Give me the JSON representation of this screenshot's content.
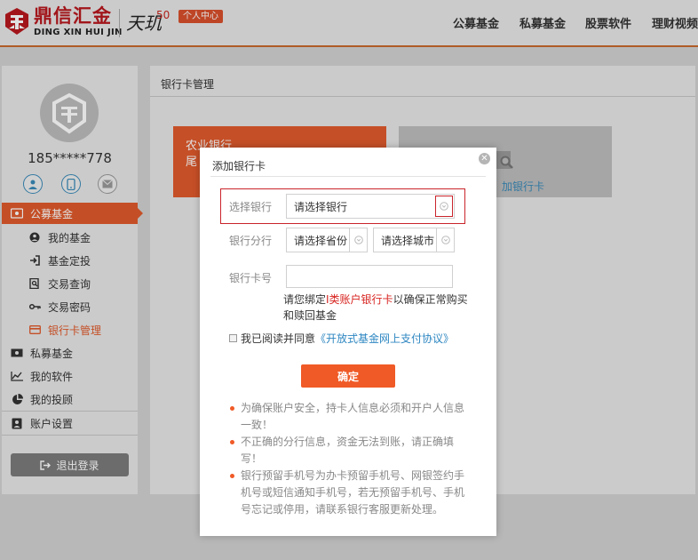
{
  "header": {
    "logo_cn": "鼎信汇金",
    "logo_en": "DING XIN HUI JIN",
    "brand2": "天玑",
    "brand2_num": "50",
    "badge": "个人中心",
    "nav": [
      "公募基金",
      "私募基金",
      "股票软件",
      "理财视频"
    ],
    "accent": "#c8692e"
  },
  "sidebar": {
    "phone": "185*****778",
    "menu": {
      "public_fund": "公募基金",
      "my_fund": "我的基金",
      "fund_fixed": "基金定投",
      "trade_query": "交易查询",
      "trade_password": "交易密码",
      "bank_card_manage": "银行卡管理",
      "private_fund": "私募基金",
      "my_software": "我的软件",
      "my_advisor": "我的投顾",
      "account_settings": "账户设置"
    },
    "logout": "退出登录",
    "accent": "#e05a2c"
  },
  "main": {
    "breadcrumb": "银行卡管理",
    "card_bank": "农业银行",
    "card_tail": "尾",
    "add_card_partial": "加银行卡"
  },
  "modal": {
    "title": "添加银行卡",
    "select_bank_label": "选择银行",
    "select_bank_value": "请选择银行",
    "branch_label": "银行分行",
    "province_value": "请选择省份",
    "city_value": "请选择城市",
    "card_number_label": "银行卡号",
    "card_number_value": "",
    "hint_prefix": "请您绑定",
    "hint_red": "I类账户银行卡",
    "hint_suffix": "以确保正常购买和赎回基金",
    "agree_text": "我已阅读并同意",
    "agree_link": "《开放式基金网上支付协议》",
    "confirm": "确定",
    "notes": [
      "为确保账户安全，持卡人信息必须和开户人信息一致！",
      "不正确的分行信息，资金无法到账，请正确填写！",
      "银行预留手机号为办卡预留手机号、网银签约手机号或短信通知手机号，若无预留手机号、手机号忘记或停用，请联系银行客服更新处理。"
    ],
    "confirm_color": "#f05a26",
    "highlight_color": "#c9242b"
  }
}
